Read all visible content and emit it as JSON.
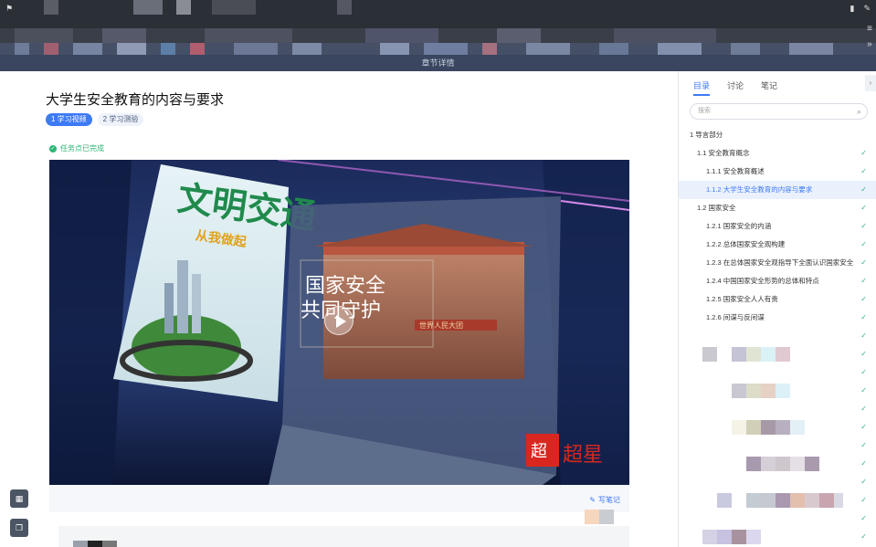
{
  "header": {
    "bar_label": "章节详情",
    "corner_left_icon": "flag-icon",
    "corner_right_icons": [
      "bookmark-icon",
      "pen-icon"
    ],
    "side_icons": [
      "menu-icon",
      "expand-icon"
    ]
  },
  "course": {
    "title": "大学生安全教育的内容与要求",
    "tabs": [
      {
        "label": "1 学习视频",
        "active": true
      },
      {
        "label": "2 学习测验",
        "active": false
      }
    ],
    "task_status": "任务点已完成"
  },
  "video": {
    "poster_text_left": "文明交通",
    "poster_subtext_left": "从我做起",
    "poster_text_center_1": "国家安全",
    "poster_text_center_2": "共同守护",
    "gate_sign": "世界人民大团",
    "brand_text": "超星"
  },
  "note_link": "写笔记",
  "left_tools": [
    {
      "icon": "grid-icon"
    },
    {
      "icon": "layers-icon"
    }
  ],
  "sidebar": {
    "tabs": [
      {
        "label": "目录",
        "active": true
      },
      {
        "label": "讨论",
        "active": false
      },
      {
        "label": "笔记",
        "active": false
      }
    ],
    "search_placeholder": "搜索",
    "items": [
      {
        "label": "1 导言部分",
        "level": 0,
        "selected": false,
        "done": false
      },
      {
        "label": "1.1 安全教育概念",
        "level": 1,
        "selected": false,
        "done": true
      },
      {
        "label": "1.1.1 安全教育概述",
        "level": 2,
        "selected": false,
        "done": true
      },
      {
        "label": "1.1.2 大学生安全教育的内容与要求",
        "level": 2,
        "selected": true,
        "done": true
      },
      {
        "label": "1.2 国家安全",
        "level": 1,
        "selected": false,
        "done": true
      },
      {
        "label": "1.2.1 国家安全的内涵",
        "level": 2,
        "selected": false,
        "done": true
      },
      {
        "label": "1.2.2 总体国家安全观构建",
        "level": 2,
        "selected": false,
        "done": true
      },
      {
        "label": "1.2.3 在总体国家安全观指导下全面认识国家安全",
        "level": 2,
        "selected": false,
        "done": true
      },
      {
        "label": "1.2.4 中国国家安全形势的总体和特点",
        "level": 2,
        "selected": false,
        "done": true
      },
      {
        "label": "1.2.5 国家安全人人有责",
        "level": 2,
        "selected": false,
        "done": true
      },
      {
        "label": "1.2.6 间谍与反间谍",
        "level": 2,
        "selected": false,
        "done": true
      }
    ]
  },
  "colors": {
    "accent": "#3d7af5",
    "done": "#2bb673",
    "header_bg": "#2b2f36"
  }
}
